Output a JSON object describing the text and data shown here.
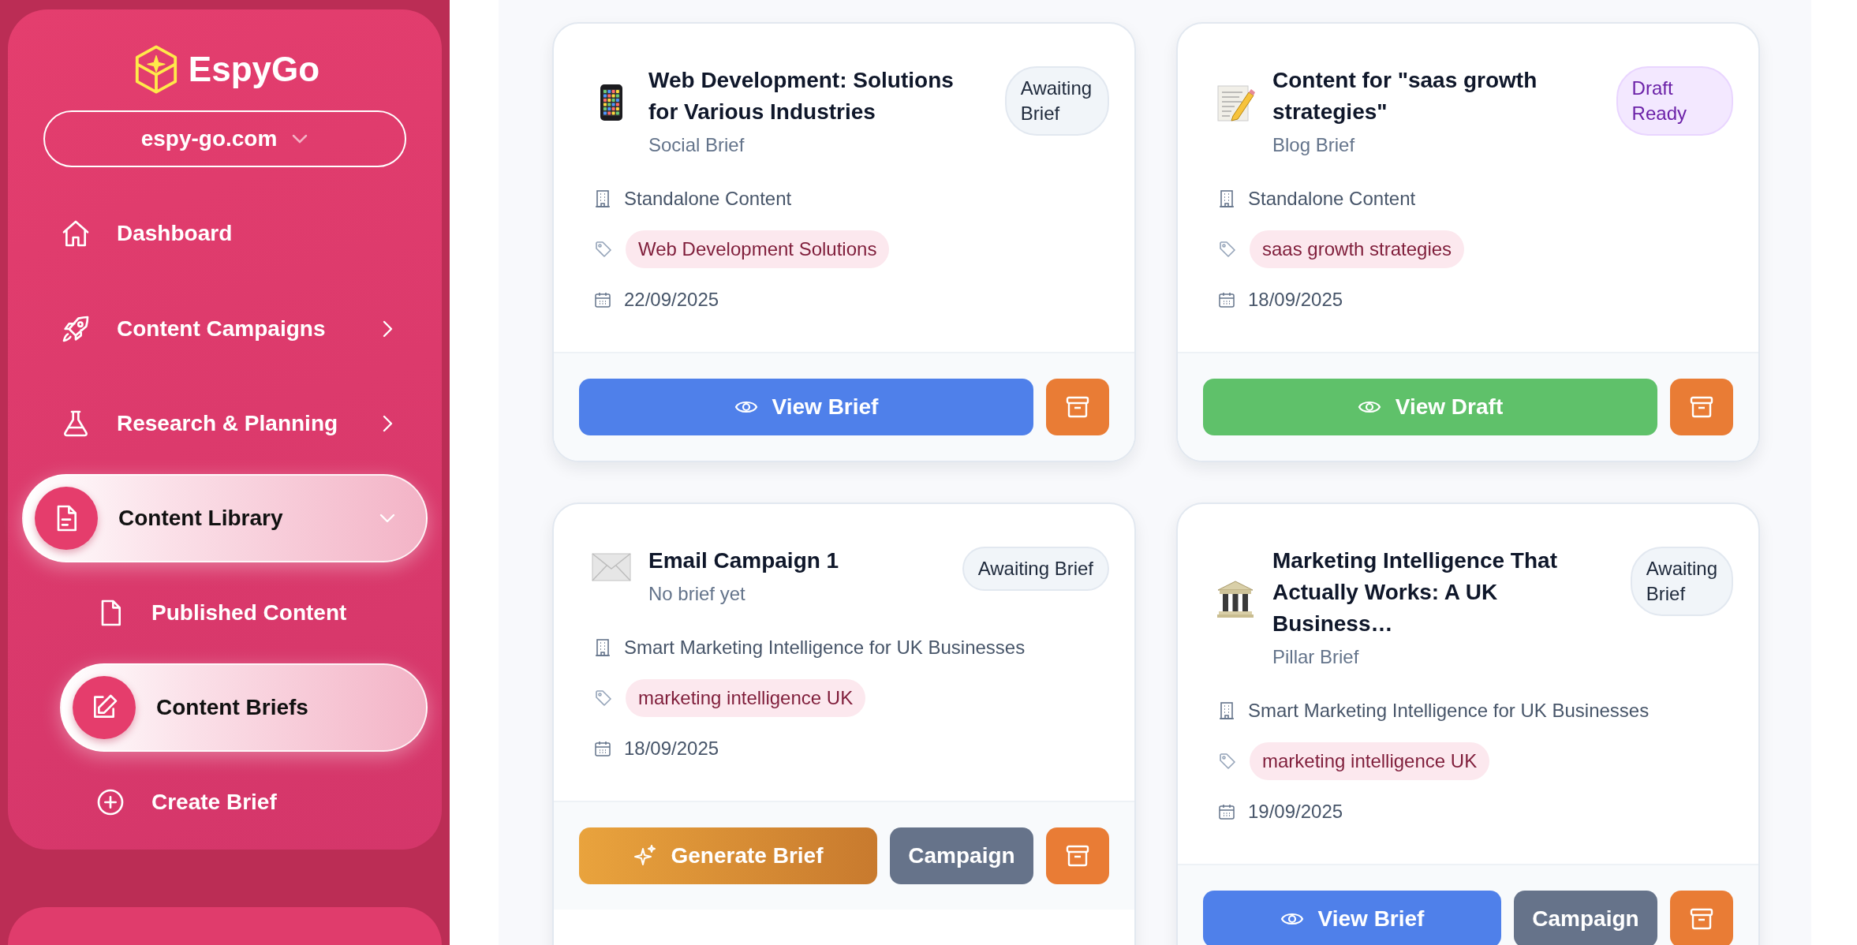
{
  "sidebar": {
    "logo": "EspyGo",
    "site_selector": "espy-go.com",
    "items": [
      {
        "label": "Dashboard",
        "kind": "home",
        "selected": false
      },
      {
        "label": "Content Campaigns",
        "kind": "rocket",
        "selected": false,
        "expanded": false
      },
      {
        "label": "Research & Planning",
        "kind": "flask",
        "selected": false,
        "expanded": false
      },
      {
        "label": "Content Library",
        "kind": "document",
        "selected": true,
        "expanded": true,
        "children": [
          {
            "label": "Published Content",
            "kind": "page",
            "selected": false
          },
          {
            "label": "Content Briefs",
            "kind": "edit",
            "selected": true
          },
          {
            "label": "Create Brief",
            "kind": "plus",
            "selected": false
          }
        ]
      }
    ]
  },
  "cards": [
    {
      "kind": "social",
      "title": "Web Development: Solutions for Various Industries",
      "subtitle": "Social Brief",
      "status": {
        "label": "Awaiting Brief",
        "kind": "awaiting"
      },
      "campaign": "Standalone Content",
      "tag": "Web Development Solutions",
      "date": "22/09/2025",
      "buttons": [
        {
          "kind": "view",
          "label": "View Brief"
        },
        {
          "kind": "archive"
        }
      ]
    },
    {
      "kind": "blog",
      "title": "Content for \"saas growth strategies\"",
      "subtitle": "Blog Brief",
      "status": {
        "label": "Draft Ready",
        "kind": "draft"
      },
      "campaign": "Standalone Content",
      "tag": "saas growth strategies",
      "date": "18/09/2025",
      "buttons": [
        {
          "kind": "draft",
          "label": "View Draft"
        },
        {
          "kind": "archive"
        }
      ]
    },
    {
      "kind": "email",
      "title": "Email Campaign 1",
      "subtitle": "No brief yet",
      "status": {
        "label": "Awaiting Brief",
        "kind": "awaiting"
      },
      "campaign": "Smart Marketing Intelligence for UK Businesses",
      "tag": "marketing intelligence UK",
      "date": "18/09/2025",
      "buttons": [
        {
          "kind": "generate",
          "label": "Generate Brief"
        },
        {
          "kind": "campaign",
          "label": "Campaign"
        },
        {
          "kind": "archive"
        }
      ]
    },
    {
      "kind": "pillar",
      "title": "Marketing Intelligence That Actually Works: A UK Business…",
      "subtitle": "Pillar Brief",
      "status": {
        "label": "Awaiting Brief",
        "kind": "awaiting"
      },
      "campaign": "Smart Marketing Intelligence for UK Businesses",
      "tag": "marketing intelligence UK",
      "date": "19/09/2025",
      "buttons": [
        {
          "kind": "view",
          "label": "View Brief"
        },
        {
          "kind": "campaign",
          "label": "Campaign"
        },
        {
          "kind": "archive"
        }
      ]
    }
  ]
}
